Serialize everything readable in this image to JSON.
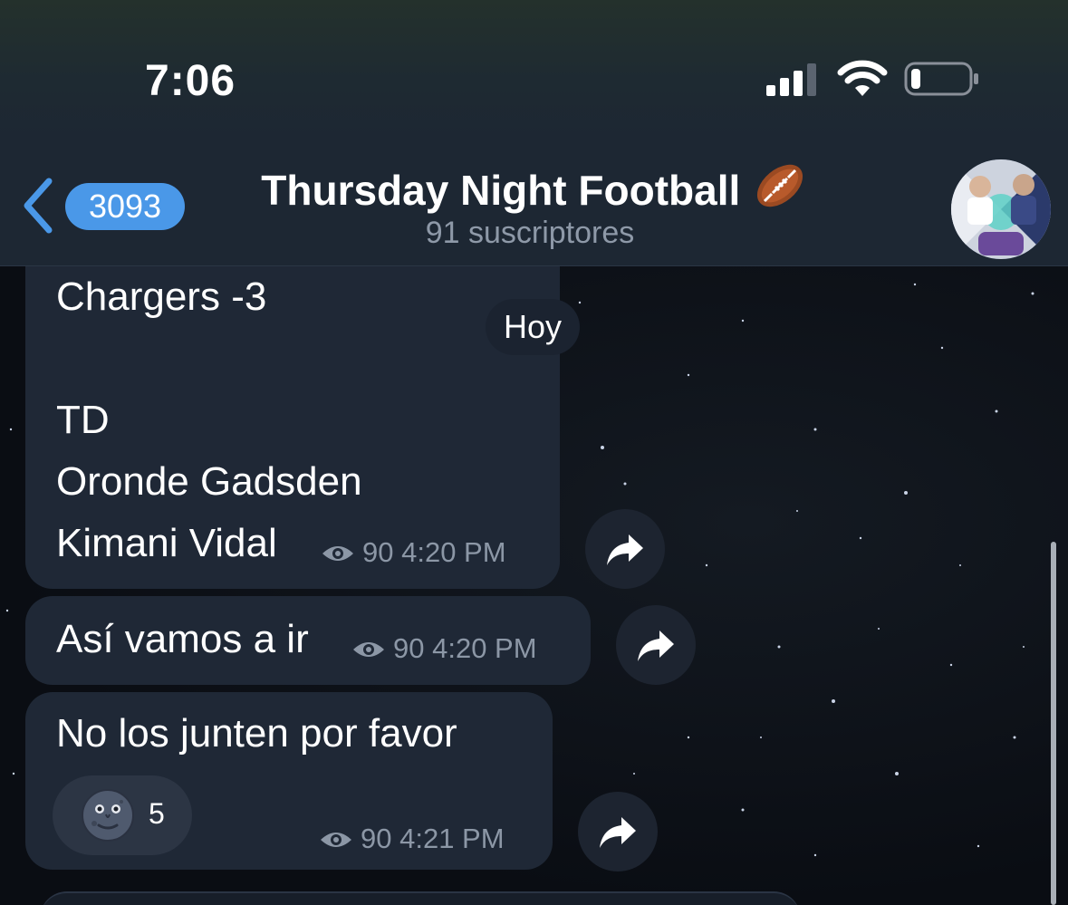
{
  "status_bar": {
    "time": "7:06"
  },
  "header": {
    "back_badge": "3093",
    "title": "Thursday Night Football",
    "subtitle": "91 suscriptores"
  },
  "date_separator": "Hoy",
  "messages": [
    {
      "lines": [
        "Chargers -3",
        "",
        "TD",
        "Oronde Gadsden",
        "Kimani Vidal"
      ],
      "views": "90",
      "time": "4:20 PM"
    },
    {
      "lines": [
        "Así vamos a ir"
      ],
      "views": "90",
      "time": "4:20 PM"
    },
    {
      "lines": [
        "No los junten por favor"
      ],
      "views": "90",
      "time": "4:21 PM",
      "reaction": {
        "emoji": "new-moon-face",
        "count": "5"
      }
    }
  ],
  "colors": {
    "header_bg": "#1d2733",
    "bubble_bg": "#1f2836",
    "badge_bg": "#4a98e8",
    "meta_text": "#8c97a6"
  }
}
